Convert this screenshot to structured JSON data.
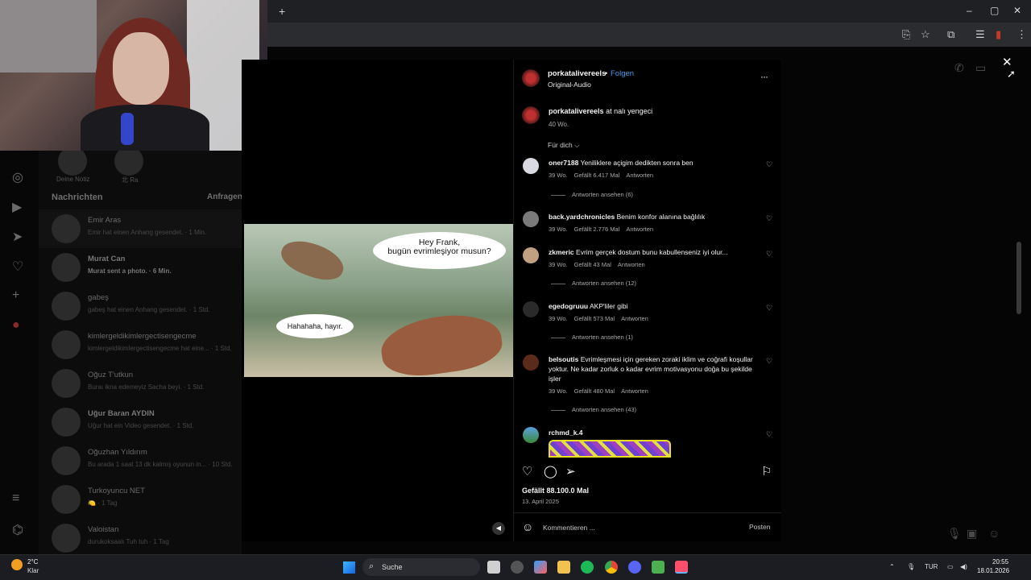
{
  "browser": {
    "new_tab_symbol": "+",
    "controls": {
      "minimize": "–",
      "maximize": "▢",
      "close": "✕"
    }
  },
  "instagram_bg": {
    "stories": [
      {
        "name": "Deine Notiz"
      },
      {
        "name": "北 Ra"
      }
    ],
    "messages_header": "Nachrichten",
    "requests_label": "Anfragen",
    "conversations": [
      {
        "name": "Emir Aras",
        "preview": "Emir hat einen Anhang gesendet. · 1 Min."
      },
      {
        "name": "Murat Can",
        "preview": "Murat sent a photo. · 6 Min."
      },
      {
        "name": "gabeş",
        "preview": "gabeş hat einen Anhang gesendet. · 1 Std."
      },
      {
        "name": "kimlergeldikimlergecti​sengecme",
        "preview": "kimlergeldikimlergectisengecme hat eine... · 1 Std."
      },
      {
        "name": "Oğuz T'utkun",
        "preview": "Buraı ikna edemeyiz Sacha beyi. · 1 Std."
      },
      {
        "name": "Uğur Baran AYDIN",
        "preview": "Uğur hat ein Video gesendet. · 1 Std."
      },
      {
        "name": "Oğuzhan Yıldırım",
        "preview": "Bu arada 1 saat 13 dk kalmış oyunun in... · 10 Std."
      },
      {
        "name": "Turkoyuncu NET",
        "preview": "🍋 · 1 Tag"
      },
      {
        "name": "Valoistan",
        "preview": "durukoksaalı Tuh tuh · 1 Tag"
      }
    ]
  },
  "reel": {
    "comic_bubble_1_line1": "Hey Frank,",
    "comic_bubble_1_line2": "bugün evrimleşiyor musun?",
    "comic_bubble_2": "Hahahaha, hayır.",
    "mute_icon": "◀"
  },
  "post": {
    "owner": "porkatalivereels",
    "separator": "•",
    "follow_label": "Folgen",
    "audio": "Original-Audio",
    "more_label": "···",
    "caption_user": "porkatalivereels",
    "caption_text": "at nalı yengeci",
    "caption_time": "40 Wo.",
    "filter_label": "Für dich ⌵",
    "comments": [
      {
        "user": "oner7188",
        "text": "Yeniliklere açigim dedikten sonra ben",
        "time": "39 Wo.",
        "likes": "Gefällt 6.417 Mal",
        "reply": "Antworten",
        "replies": "Antworten ansehen (6)"
      },
      {
        "user": "back.yardchronicles",
        "text": "Benim konfor alanına bağlılık",
        "time": "39 Wo.",
        "likes": "Gefällt 2.776 Mal",
        "reply": "Antworten",
        "replies": ""
      },
      {
        "user": "zkmeric",
        "text": "Evrim gerçek dostum bunu kabullenseniz iyi olur...",
        "time": "39 Wo.",
        "likes": "Gefällt 43 Mal",
        "reply": "Antworten",
        "replies": "Antworten ansehen (12)"
      },
      {
        "user": "egedogruuu",
        "text": "AKP'liler gibi",
        "time": "39 Wo.",
        "likes": "Gefällt 573 Mal",
        "reply": "Antworten",
        "replies": "Antworten ansehen (1)"
      },
      {
        "user": "belsoutis",
        "text": "Evrimleşmesi için gereken zoraki iklim ve coğrafi koşullar yoktur. Ne kadar zorluk o kadar evrim motivasyonu doğa bu şekilde işler",
        "time": "39 Wo.",
        "likes": "Gefällt 480 Mal",
        "reply": "Antworten",
        "replies": "Antworten ansehen (43)"
      },
      {
        "user": "rchmd_k.4",
        "text": "",
        "time": "",
        "likes": "",
        "reply": "",
        "replies": ""
      }
    ],
    "heart_icon": "♡",
    "likes_total": "Gefällt 88.100.0 Mal",
    "date": "13. April 2025",
    "comment_placeholder": "Kommentieren ...",
    "post_button": "Posten",
    "close_icon": "✕"
  },
  "taskbar": {
    "weather_temp": "2°C",
    "weather_cond": "Klar",
    "search_label": "Suche",
    "language": "TUR",
    "time": "20:55",
    "date": "18.01.2026"
  },
  "colors": {
    "link_blue": "#4a9cf0",
    "bg": "#000000",
    "text": "#f5f5f5",
    "muted": "#a8a8a8"
  }
}
